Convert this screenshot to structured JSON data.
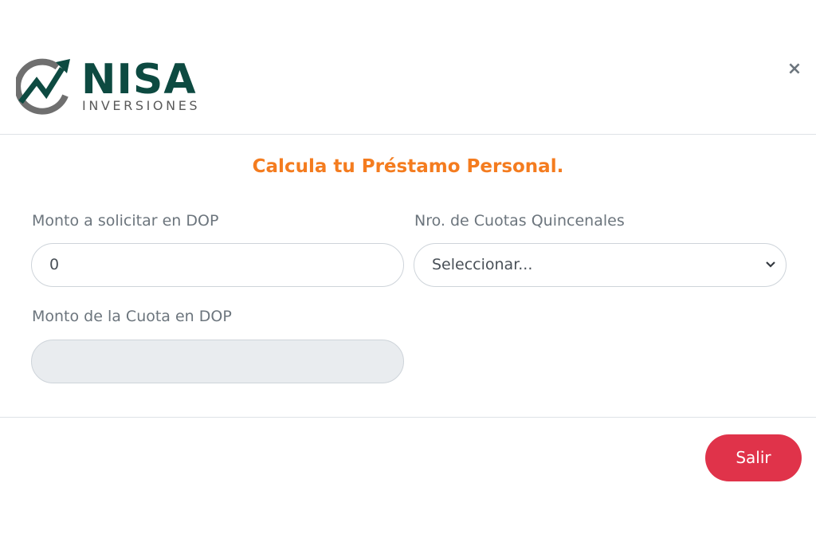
{
  "brand": {
    "name": "NISA",
    "subtitle": "INVERSIONES",
    "primary_color": "#0d4a41",
    "accent_color": "#f47c1f"
  },
  "header": {
    "close_label": "×"
  },
  "form": {
    "title": "Calcula tu Préstamo Personal.",
    "amount_label": "Monto a solicitar en DOP",
    "amount_value": "0",
    "installments_label": "Nro. de Cuotas Quincenales",
    "installments_selected": "Seleccionar...",
    "installment_amount_label": "Monto de la Cuota en DOP",
    "installment_amount_value": ""
  },
  "footer": {
    "exit_label": "Salir",
    "exit_color": "#e0334a"
  }
}
